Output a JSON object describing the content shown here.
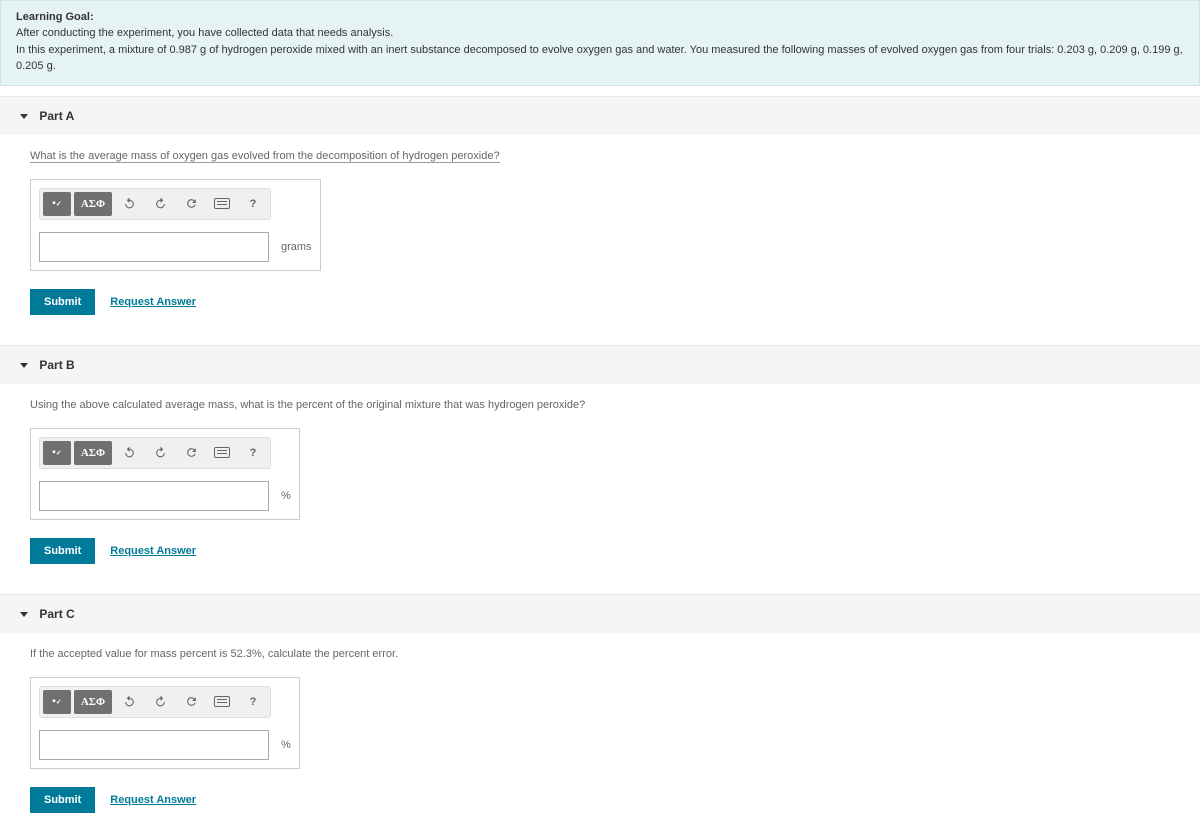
{
  "learning_goal": {
    "title": "Learning Goal:",
    "line1": "After conducting the experiment, you have collected data that needs analysis.",
    "line2": "In this experiment, a mixture of 0.987 g of hydrogen peroxide mixed with an inert substance decomposed to evolve oxygen gas and water.  You measured the following masses of evolved oxygen gas from four trials: 0.203 g, 0.209 g, 0.199 g, 0.205 g."
  },
  "toolbar": {
    "templates_label": "∎",
    "fraction_label": "⁄",
    "greek_label": "ΑΣΦ",
    "help_label": "?"
  },
  "parts": {
    "a": {
      "header": "Part A",
      "question": "What is the average mass of oxygen gas evolved from the decomposition of hydrogen peroxide?",
      "value": "",
      "unit": "grams",
      "submit": "Submit",
      "request": "Request Answer"
    },
    "b": {
      "header": "Part B",
      "question": "Using the above calculated average mass, what is the percent of the original mixture that was hydrogen peroxide?",
      "value": "",
      "unit": "%",
      "submit": "Submit",
      "request": "Request Answer"
    },
    "c": {
      "header": "Part C",
      "question": "If the accepted value for mass percent is 52.3%, calculate the percent error.",
      "value": "",
      "unit": "%",
      "submit": "Submit",
      "request": "Request Answer"
    }
  }
}
